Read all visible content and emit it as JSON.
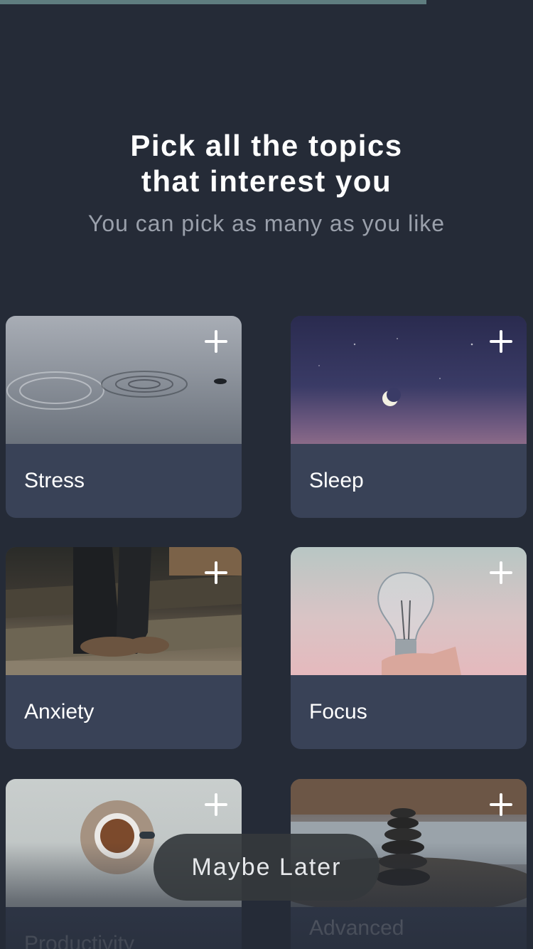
{
  "progress": {
    "fraction": 0.8
  },
  "header": {
    "title_line1": "Pick all the topics",
    "title_line2": "that interest you",
    "subtitle": "You can pick as many as you like"
  },
  "topics": [
    {
      "label": "Stress"
    },
    {
      "label": "Sleep"
    },
    {
      "label": "Anxiety"
    },
    {
      "label": "Focus"
    },
    {
      "label": "Productivity"
    },
    {
      "label": "Advanced"
    }
  ],
  "actions": {
    "maybe_later": "Maybe Later"
  },
  "colors": {
    "background": "#252b37",
    "card": "#394257",
    "progress": "#5f7d7f"
  },
  "icons": {
    "add": "plus-icon"
  }
}
